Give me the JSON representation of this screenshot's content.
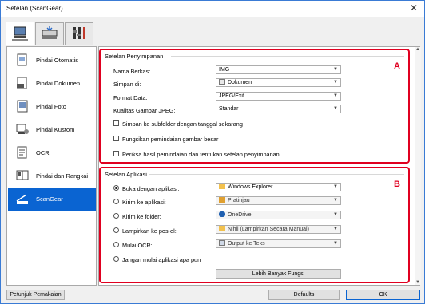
{
  "window": {
    "title": "Setelan (ScanGear)"
  },
  "top_tabs": [
    {
      "icon": "scan-from-computer-icon"
    },
    {
      "icon": "scan-from-panel-icon"
    },
    {
      "icon": "general-settings-icon"
    }
  ],
  "sidebar": {
    "items": [
      {
        "label": "Pindai Otomatis",
        "icon": "auto-scan-icon"
      },
      {
        "label": "Pindai Dokumen",
        "icon": "document-scan-icon"
      },
      {
        "label": "Pindai Foto",
        "icon": "photo-scan-icon"
      },
      {
        "label": "Pindai Kustom",
        "icon": "custom-scan-icon"
      },
      {
        "label": "OCR",
        "icon": "ocr-icon"
      },
      {
        "label": "Pindai dan Rangkai",
        "icon": "scan-and-stitch-icon"
      },
      {
        "label": "ScanGear",
        "icon": "scangear-icon",
        "selected": true
      }
    ]
  },
  "save_settings": {
    "header": "Setelan Penyimpanan",
    "badge": "A",
    "file_name_label": "Nama Berkas:",
    "file_name_value": "IMG",
    "save_in_label": "Simpan di:",
    "save_in_value": "Dokumen",
    "data_format_label": "Format Data:",
    "data_format_value": "JPEG/Exif",
    "jpeg_quality_label": "Kualitas Gambar JPEG:",
    "jpeg_quality_value": "Standar",
    "checkbox_subfolder": "Simpan ke subfolder dengan tanggal sekarang",
    "checkbox_large_scan": "Fungsikan pemindaian gambar besar",
    "checkbox_check_results": "Periksa hasil pemindaian dan tentukan setelan penyimpanan"
  },
  "app_settings": {
    "header": "Setelan Aplikasi",
    "badge": "B",
    "open_with_label": "Buka dengan aplikasi:",
    "open_with_value": "Windows Explorer",
    "send_to_app_label": "Kirim ke aplikasi:",
    "send_to_app_value": "Pratinjau",
    "send_to_folder_label": "Kirim ke folder:",
    "send_to_folder_value": "OneDrive",
    "attach_email_label": "Lampirkan ke pos-el:",
    "attach_email_value": "Nihil (Lampirkan Secara Manual)",
    "start_ocr_label": "Mulai OCR:",
    "start_ocr_value": "Output ke Teks",
    "no_app_label": "Jangan mulai aplikasi apa pun",
    "more_functions": "Lebih Banyak Fungsi"
  },
  "footer": {
    "instructions": "Petunjuk Pemakaian",
    "defaults": "Defaults",
    "ok": "OK"
  },
  "colors": {
    "accent": "#0a64d2",
    "highlight_border": "#e00020"
  }
}
